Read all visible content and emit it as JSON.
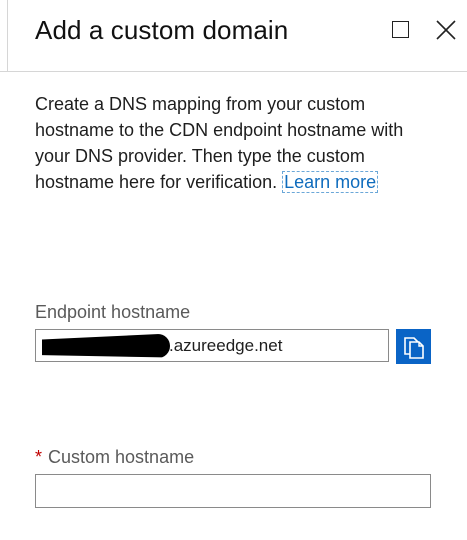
{
  "header": {
    "title": "Add a custom domain"
  },
  "description": {
    "text": "Create a DNS mapping from your custom hostname to the CDN endpoint hostname with your DNS provider. Then type the custom hostname here for verification. ",
    "link_text": "Learn more"
  },
  "endpoint": {
    "label": "Endpoint hostname",
    "value_suffix": ".azureedge.net"
  },
  "custom_hostname": {
    "required_marker": "*",
    "label": "Custom hostname",
    "value": ""
  },
  "icons": {
    "maximize": "maximize-icon",
    "close": "close-icon",
    "copy": "copy-icon"
  },
  "colors": {
    "accent": "#0a64c6",
    "link": "#0f6cbd",
    "required": "#c00000"
  }
}
